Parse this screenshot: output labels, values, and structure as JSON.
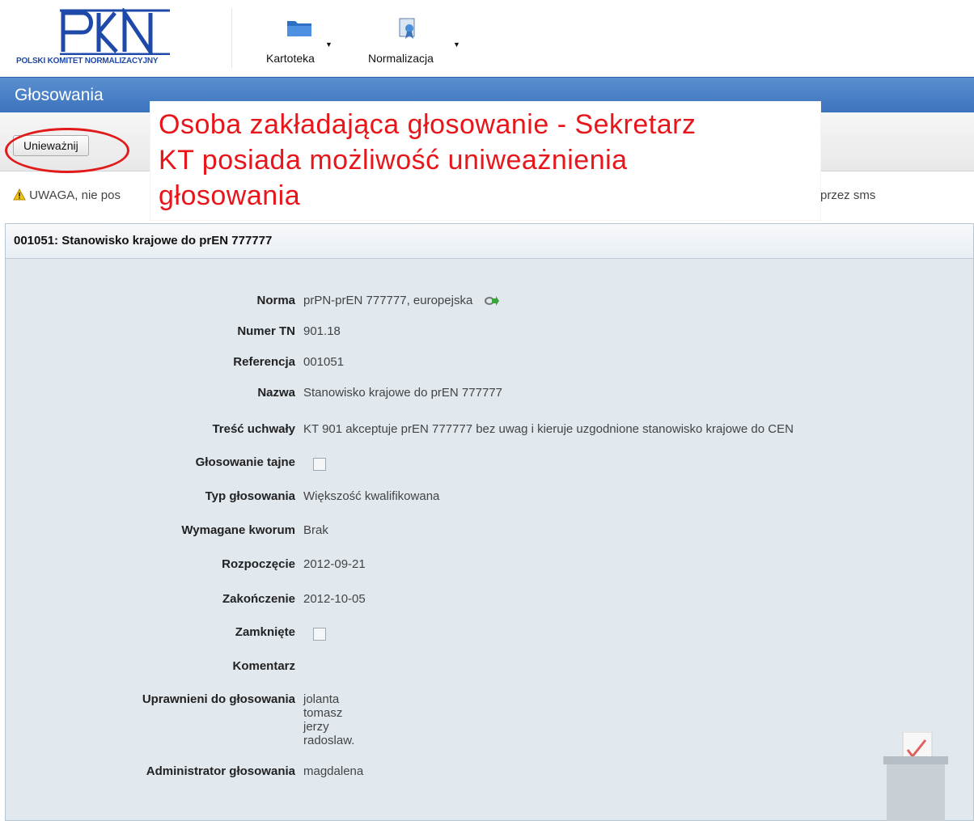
{
  "header": {
    "logo_text": "POLSKI KOMITET NORMALIZACYJNY",
    "menu": [
      {
        "label": "Kartoteka",
        "icon": "folder-icon"
      },
      {
        "label": "Normalizacja",
        "icon": "certificate-icon"
      }
    ]
  },
  "page": {
    "title": "Głosowania",
    "button_label": "Unieważnij",
    "warning_text": "UWAGA, nie pos",
    "warning_tail": "przez sms"
  },
  "annotation": {
    "line1": "Osoba zakładająca głosowanie - Sekretarz",
    "line2": "KT posiada możliwość uniweażnienia",
    "line3": "głosowania"
  },
  "panel": {
    "title": "001051: Stanowisko krajowe do prEN 777777",
    "fields": {
      "norma": {
        "label": "Norma",
        "value": "prPN-prEN 777777, europejska"
      },
      "numer_tn": {
        "label": "Numer TN",
        "value": "901.18"
      },
      "referencja": {
        "label": "Referencja",
        "value": "001051"
      },
      "nazwa": {
        "label": "Nazwa",
        "value": "Stanowisko krajowe do prEN 777777"
      },
      "tresc": {
        "label": "Treść uchwały",
        "value": "KT 901 akceptuje prEN 777777 bez uwag i kieruje uzgodnione stanowisko krajowe do CEN"
      },
      "tajne": {
        "label": "Głosowanie tajne"
      },
      "typ": {
        "label": "Typ głosowania",
        "value": "Większość kwalifikowana"
      },
      "kworum": {
        "label": "Wymagane kworum",
        "value": "Brak"
      },
      "start": {
        "label": "Rozpoczęcie",
        "value": "2012-09-21"
      },
      "end": {
        "label": "Zakończenie",
        "value": "2012-10-05"
      },
      "zamkniete": {
        "label": "Zamknięte"
      },
      "komentarz": {
        "label": "Komentarz",
        "value": ""
      },
      "uprawnieni": {
        "label": "Uprawnieni do głosowania",
        "values": [
          "jolanta",
          "tomasz",
          "jerzy",
          "radoslaw."
        ]
      },
      "admin": {
        "label": "Administrator głosowania",
        "value": "magdalena"
      }
    }
  },
  "colors": {
    "brand_blue": "#1f49a8",
    "title_bar": "#4a80c6",
    "annotation_red": "#e8151a",
    "panel_bg": "#e1e8ee"
  }
}
